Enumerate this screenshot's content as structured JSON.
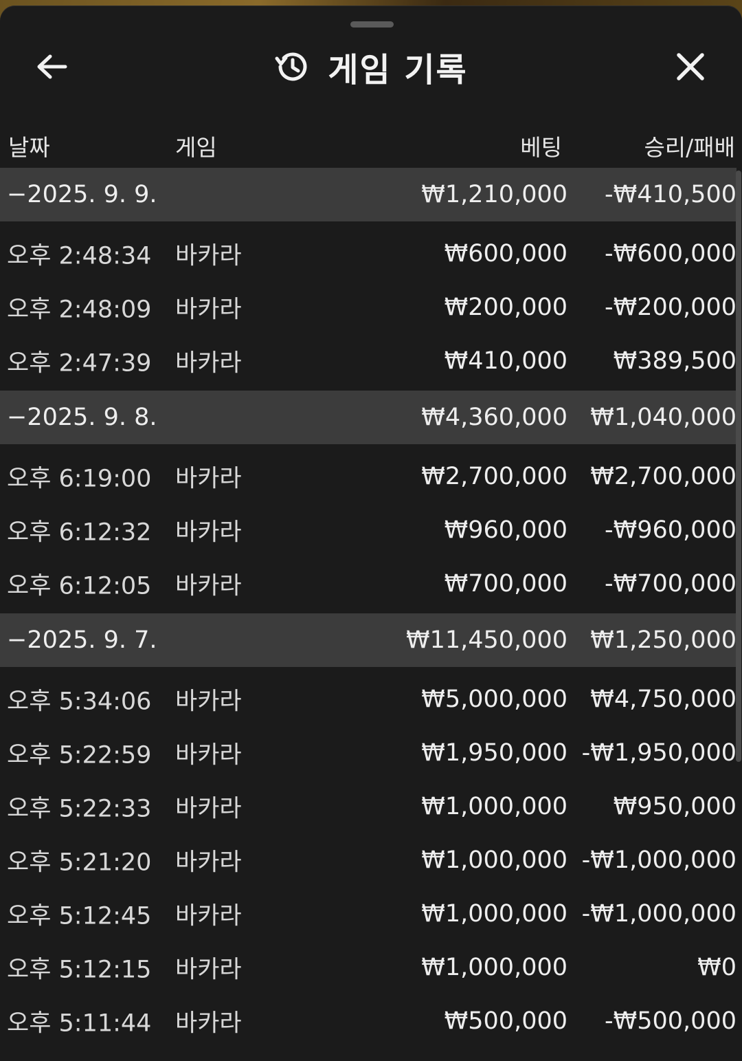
{
  "title": "게임 기록",
  "columns": {
    "date": "날짜",
    "game": "게임",
    "bet": "베팅",
    "winloss": "승리/패배"
  },
  "icons": {
    "back": "back-arrow-icon",
    "history": "history-clock-icon",
    "close": "close-icon"
  },
  "colors": {
    "background": "#1b1b1b",
    "day_header": "#3c3c3c",
    "text": "#eeeeee"
  },
  "days": [
    {
      "date": "−2025. 9. 9.",
      "bet": "₩1,210,000",
      "winloss": "-₩410,500",
      "rows": [
        {
          "time": "오후 2:48:34",
          "game": "바카라",
          "bet": "₩600,000",
          "winloss": "-₩600,000"
        },
        {
          "time": "오후 2:48:09",
          "game": "바카라",
          "bet": "₩200,000",
          "winloss": "-₩200,000"
        },
        {
          "time": "오후 2:47:39",
          "game": "바카라",
          "bet": "₩410,000",
          "winloss": "₩389,500"
        }
      ]
    },
    {
      "date": "−2025. 9. 8.",
      "bet": "₩4,360,000",
      "winloss": "₩1,040,000",
      "rows": [
        {
          "time": "오후 6:19:00",
          "game": "바카라",
          "bet": "₩2,700,000",
          "winloss": "₩2,700,000"
        },
        {
          "time": "오후 6:12:32",
          "game": "바카라",
          "bet": "₩960,000",
          "winloss": "-₩960,000"
        },
        {
          "time": "오후 6:12:05",
          "game": "바카라",
          "bet": "₩700,000",
          "winloss": "-₩700,000"
        }
      ]
    },
    {
      "date": "−2025. 9. 7.",
      "bet": "₩11,450,000",
      "winloss": "₩1,250,000",
      "rows": [
        {
          "time": "오후 5:34:06",
          "game": "바카라",
          "bet": "₩5,000,000",
          "winloss": "₩4,750,000"
        },
        {
          "time": "오후 5:22:59",
          "game": "바카라",
          "bet": "₩1,950,000",
          "winloss": "-₩1,950,000"
        },
        {
          "time": "오후 5:22:33",
          "game": "바카라",
          "bet": "₩1,000,000",
          "winloss": "₩950,000"
        },
        {
          "time": "오후 5:21:20",
          "game": "바카라",
          "bet": "₩1,000,000",
          "winloss": "-₩1,000,000"
        },
        {
          "time": "오후 5:12:45",
          "game": "바카라",
          "bet": "₩1,000,000",
          "winloss": "-₩1,000,000"
        },
        {
          "time": "오후 5:12:15",
          "game": "바카라",
          "bet": "₩1,000,000",
          "winloss": "₩0"
        },
        {
          "time": "오후 5:11:44",
          "game": "바카라",
          "bet": "₩500,000",
          "winloss": "-₩500,000"
        }
      ]
    }
  ]
}
